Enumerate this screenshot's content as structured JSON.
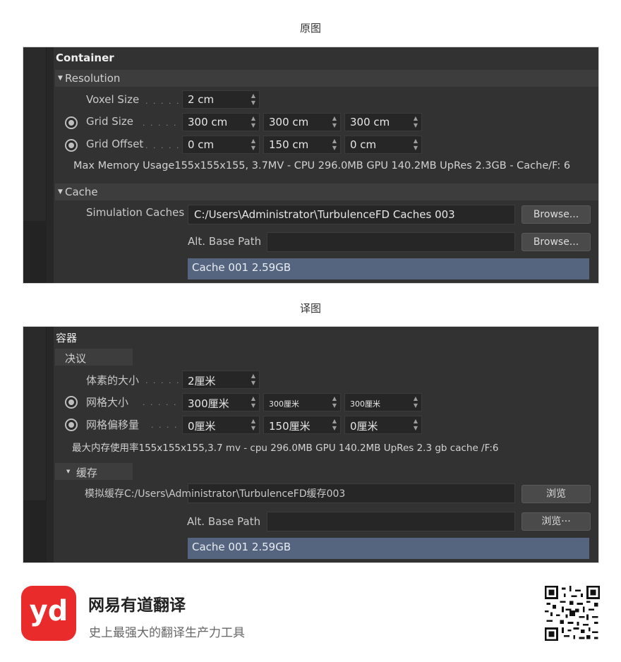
{
  "captions": {
    "original": "原图",
    "translated": "译图"
  },
  "original": {
    "title": "Container",
    "resolution": {
      "label": "Resolution"
    },
    "voxel_size": {
      "label": "Voxel Size",
      "dots": ". . . . .",
      "value": "2 cm"
    },
    "grid_size": {
      "label": "Grid Size",
      "dots": ". . . . . .",
      "values": [
        "300 cm",
        "300 cm",
        "300 cm"
      ]
    },
    "grid_offset": {
      "label": "Grid Offset",
      "dots": ". . . . .",
      "values": [
        "0 cm",
        "150 cm",
        "0 cm"
      ]
    },
    "memory_usage": "Max Memory Usage155x155x155, 3.7MV - CPU 296.0MB GPU 140.2MB UpRes 2.3GB - Cache/F: 6",
    "cache": {
      "label": "Cache"
    },
    "simulation_caches": {
      "label": "Simulation Caches",
      "value": "C:/Users\\Administrator\\TurbulenceFD Caches 003",
      "button": "Browse..."
    },
    "alt_base_path": {
      "label": "Alt. Base Path",
      "value": "",
      "button": "Browse..."
    },
    "cache_list": [
      "Cache 001  2.59GB"
    ]
  },
  "translated": {
    "title": "容器",
    "resolution": {
      "label": "决议"
    },
    "voxel_size": {
      "label": "体素的大小",
      "dots": ". . . . .",
      "value": "2厘米"
    },
    "grid_size": {
      "label": "网格大小",
      "dots": ". . . . . .",
      "values": [
        "300厘米",
        "300厘米",
        "300厘米"
      ]
    },
    "grid_offset": {
      "label": "网格偏移量",
      "dots": ". . . . .",
      "values": [
        "0厘米",
        "150厘米",
        "0厘米"
      ]
    },
    "memory_usage": "最大内存使用率155x155x155,3.7 mv - cpu 296.0MB GPU 140.2MB UpRes 2.3 gb cache /F:6",
    "cache": {
      "label": "缓存"
    },
    "simulation_caches": {
      "label": "模拟缓存",
      "value": "C:/Users\\Administrator\\TurbulenceFD缓存003",
      "button": "浏览"
    },
    "alt_base_path": {
      "label": "Alt. Base Path",
      "value": "",
      "button": "浏览···"
    },
    "cache_list": [
      "Cache 001 2.59GB"
    ]
  },
  "footer": {
    "logo_text": "yd",
    "brand_name": "网易有道翻译",
    "slogan": "史上最强大的翻译生产力工具",
    "qr_icon": "qr-code-icon"
  },
  "colors": {
    "brand_red": "#ea2b2b",
    "selection_blue": "#56657f",
    "panel_bg": "#323232"
  }
}
